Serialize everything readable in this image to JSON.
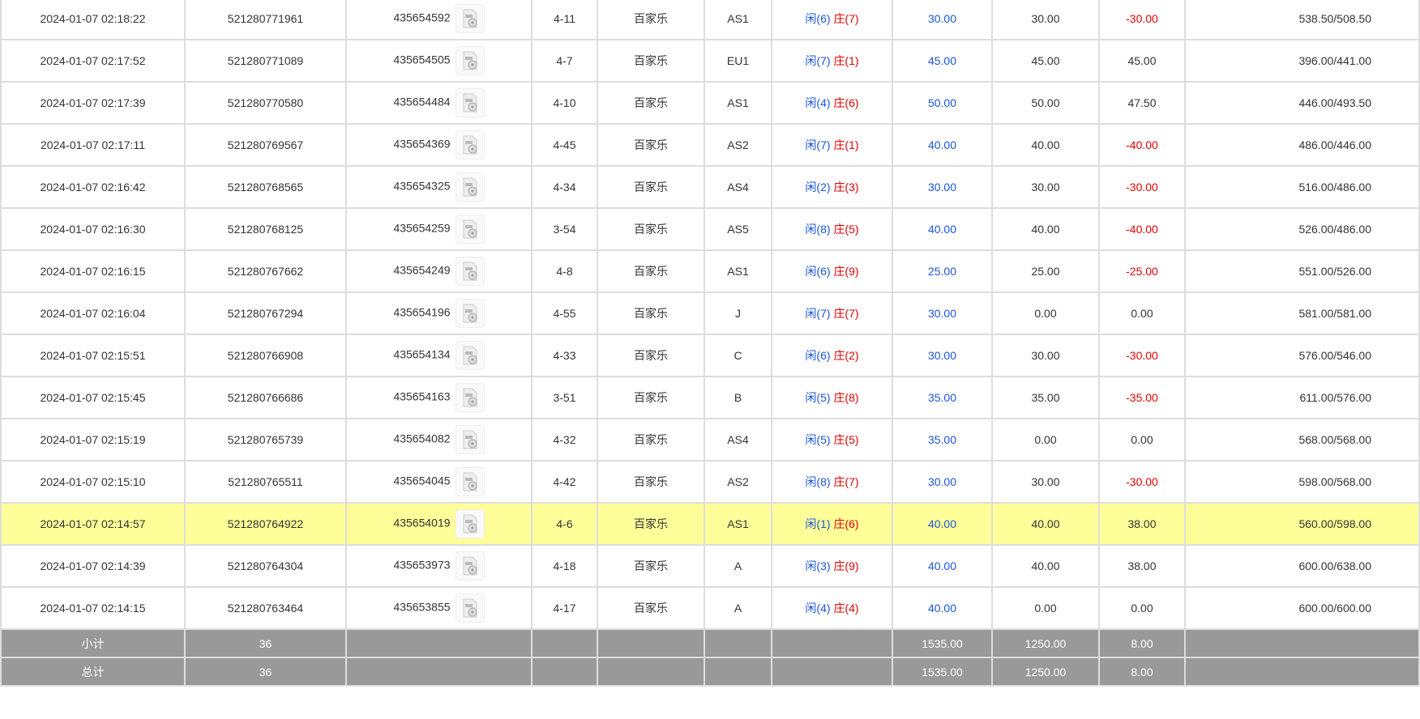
{
  "colors": {
    "highlight": "#ffff99",
    "blue": "#1a56d6",
    "red": "#e00000",
    "summary_bg": "#999999"
  },
  "rows": [
    {
      "time": "2024-01-07 02:18:22",
      "order": "521280771961",
      "round": "435654592",
      "table": "4-11",
      "game": "百家乐",
      "room": "AS1",
      "p": "闲(6)",
      "b": "庄(7)",
      "bet": "30.00",
      "valid": "30.00",
      "win": "-30.00",
      "balance": "538.50/508.50"
    },
    {
      "time": "2024-01-07 02:17:52",
      "order": "521280771089",
      "round": "435654505",
      "table": "4-7",
      "game": "百家乐",
      "room": "EU1",
      "p": "闲(7)",
      "b": "庄(1)",
      "bet": "45.00",
      "valid": "45.00",
      "win": "45.00",
      "balance": "396.00/441.00"
    },
    {
      "time": "2024-01-07 02:17:39",
      "order": "521280770580",
      "round": "435654484",
      "table": "4-10",
      "game": "百家乐",
      "room": "AS1",
      "p": "闲(4)",
      "b": "庄(6)",
      "bet": "50.00",
      "valid": "50.00",
      "win": "47.50",
      "balance": "446.00/493.50"
    },
    {
      "time": "2024-01-07 02:17:11",
      "order": "521280769567",
      "round": "435654369",
      "table": "4-45",
      "game": "百家乐",
      "room": "AS2",
      "p": "闲(7)",
      "b": "庄(1)",
      "bet": "40.00",
      "valid": "40.00",
      "win": "-40.00",
      "balance": "486.00/446.00"
    },
    {
      "time": "2024-01-07 02:16:42",
      "order": "521280768565",
      "round": "435654325",
      "table": "4-34",
      "game": "百家乐",
      "room": "AS4",
      "p": "闲(2)",
      "b": "庄(3)",
      "bet": "30.00",
      "valid": "30.00",
      "win": "-30.00",
      "balance": "516.00/486.00"
    },
    {
      "time": "2024-01-07 02:16:30",
      "order": "521280768125",
      "round": "435654259",
      "table": "3-54",
      "game": "百家乐",
      "room": "AS5",
      "p": "闲(8)",
      "b": "庄(5)",
      "bet": "40.00",
      "valid": "40.00",
      "win": "-40.00",
      "balance": "526.00/486.00"
    },
    {
      "time": "2024-01-07 02:16:15",
      "order": "521280767662",
      "round": "435654249",
      "table": "4-8",
      "game": "百家乐",
      "room": "AS1",
      "p": "闲(6)",
      "b": "庄(9)",
      "bet": "25.00",
      "valid": "25.00",
      "win": "-25.00",
      "balance": "551.00/526.00"
    },
    {
      "time": "2024-01-07 02:16:04",
      "order": "521280767294",
      "round": "435654196",
      "table": "4-55",
      "game": "百家乐",
      "room": "J",
      "p": "闲(7)",
      "b": "庄(7)",
      "bet": "30.00",
      "valid": "0.00",
      "win": "0.00",
      "balance": "581.00/581.00"
    },
    {
      "time": "2024-01-07 02:15:51",
      "order": "521280766908",
      "round": "435654134",
      "table": "4-33",
      "game": "百家乐",
      "room": "C",
      "p": "闲(6)",
      "b": "庄(2)",
      "bet": "30.00",
      "valid": "30.00",
      "win": "-30.00",
      "balance": "576.00/546.00"
    },
    {
      "time": "2024-01-07 02:15:45",
      "order": "521280766686",
      "round": "435654163",
      "table": "3-51",
      "game": "百家乐",
      "room": "B",
      "p": "闲(5)",
      "b": "庄(8)",
      "bet": "35.00",
      "valid": "35.00",
      "win": "-35.00",
      "balance": "611.00/576.00"
    },
    {
      "time": "2024-01-07 02:15:19",
      "order": "521280765739",
      "round": "435654082",
      "table": "4-32",
      "game": "百家乐",
      "room": "AS4",
      "p": "闲(5)",
      "b": "庄(5)",
      "bet": "35.00",
      "valid": "0.00",
      "win": "0.00",
      "balance": "568.00/568.00"
    },
    {
      "time": "2024-01-07 02:15:10",
      "order": "521280765511",
      "round": "435654045",
      "table": "4-42",
      "game": "百家乐",
      "room": "AS2",
      "p": "闲(8)",
      "b": "庄(7)",
      "bet": "30.00",
      "valid": "30.00",
      "win": "-30.00",
      "balance": "598.00/568.00"
    },
    {
      "time": "2024-01-07 02:14:57",
      "order": "521280764922",
      "round": "435654019",
      "table": "4-6",
      "game": "百家乐",
      "room": "AS1",
      "p": "闲(1)",
      "b": "庄(6)",
      "bet": "40.00",
      "valid": "40.00",
      "win": "38.00",
      "balance": "560.00/598.00",
      "highlight": true
    },
    {
      "time": "2024-01-07 02:14:39",
      "order": "521280764304",
      "round": "435653973",
      "table": "4-18",
      "game": "百家乐",
      "room": "A",
      "p": "闲(3)",
      "b": "庄(9)",
      "bet": "40.00",
      "valid": "40.00",
      "win": "38.00",
      "balance": "600.00/638.00"
    },
    {
      "time": "2024-01-07 02:14:15",
      "order": "521280763464",
      "round": "435653855",
      "table": "4-17",
      "game": "百家乐",
      "room": "A",
      "p": "闲(4)",
      "b": "庄(4)",
      "bet": "40.00",
      "valid": "0.00",
      "win": "0.00",
      "balance": "600.00/600.00"
    }
  ],
  "summary": [
    {
      "label": "小计",
      "count": "36",
      "bet": "1535.00",
      "valid": "1250.00",
      "win": "8.00"
    },
    {
      "label": "总计",
      "count": "36",
      "bet": "1535.00",
      "valid": "1250.00",
      "win": "8.00"
    }
  ]
}
